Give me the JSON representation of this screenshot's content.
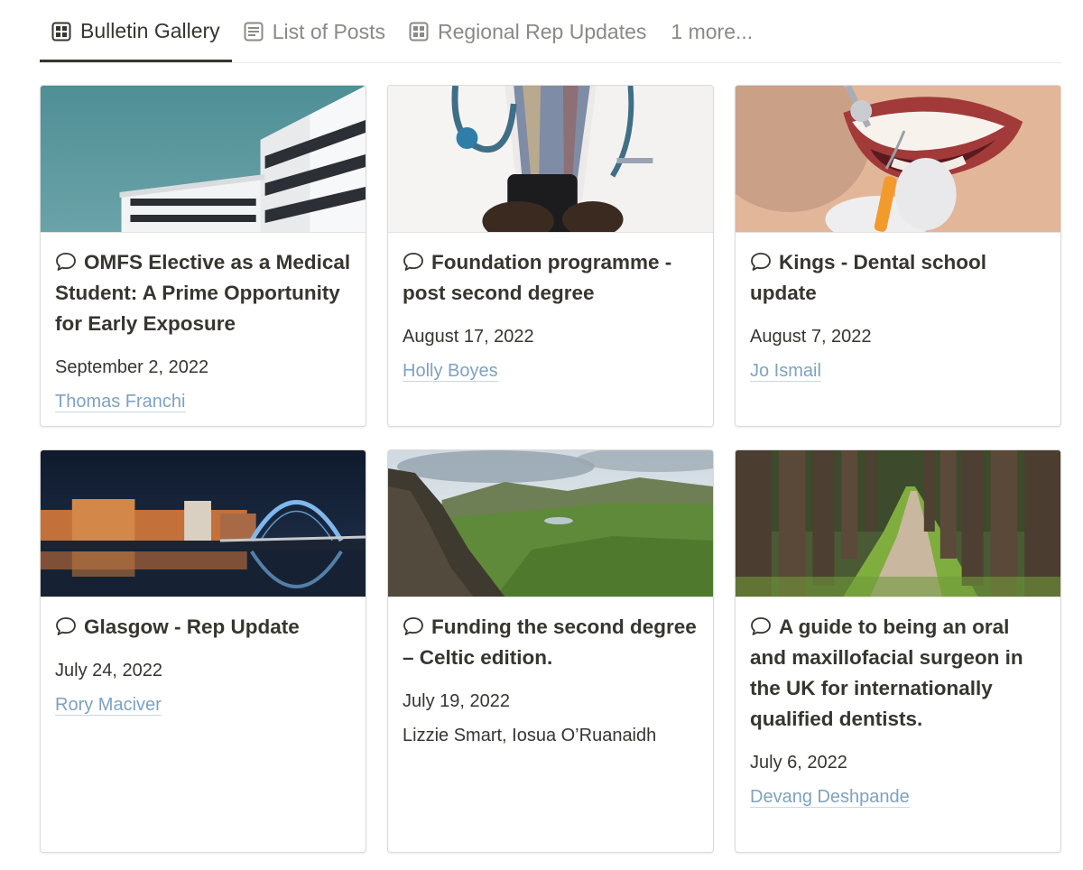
{
  "tabs": [
    {
      "label": "Bulletin Gallery",
      "icon": "gallery-icon",
      "active": true
    },
    {
      "label": "List of Posts",
      "icon": "list-icon",
      "active": false
    },
    {
      "label": "Regional Rep Updates",
      "icon": "gallery-icon",
      "active": false
    },
    {
      "label": "1 more...",
      "icon": "",
      "active": false
    }
  ],
  "cards": [
    {
      "title": "OMFS Elective as a Medical Student: A Prime Opportunity for Early Exposure",
      "date": "September 2, 2022",
      "author": "Thomas Franchi",
      "author_linked": true,
      "cover": "hospital-building"
    },
    {
      "title": "Foundation programme - post second degree",
      "date": "August 17, 2022",
      "author": "Holly Boyes",
      "author_linked": true,
      "cover": "doctor-with-phone"
    },
    {
      "title": "Kings - Dental school update",
      "date": "August 7, 2022",
      "author": "Jo Ismail",
      "author_linked": true,
      "cover": "dental-exam"
    },
    {
      "title": "Glasgow - Rep Update",
      "date": "July 24, 2022",
      "author": "Rory Maciver",
      "author_linked": true,
      "cover": "glasgow-night-bridge"
    },
    {
      "title": "Funding the second degree – Celtic edition.",
      "date": "July 19, 2022",
      "author": "Lizzie Smart, Iosua O’Ruanaidh",
      "author_linked": false,
      "cover": "green-highlands"
    },
    {
      "title": "A guide to being an oral and maxillofacial surgeon in the UK for internationally qualified dentists.",
      "date": "July 6, 2022",
      "author": "Devang Deshpande",
      "author_linked": true,
      "cover": "forest-path"
    }
  ],
  "colors": {
    "text": "#37352f",
    "muted": "#8a8985",
    "link": "#7ea2c0",
    "border": "#dcdbd8"
  }
}
